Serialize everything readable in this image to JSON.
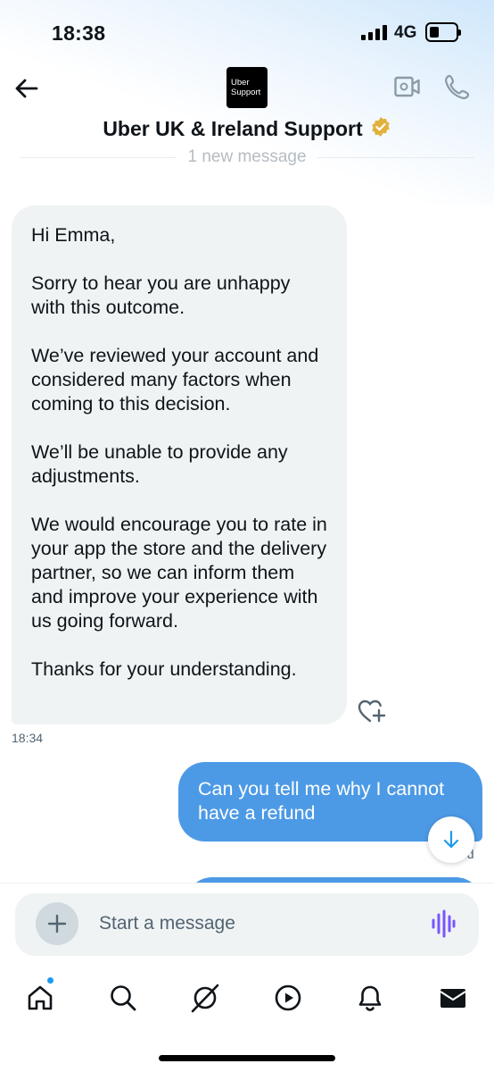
{
  "status_bar": {
    "time": "18:38",
    "network": "4G"
  },
  "header": {
    "logo_line1": "Uber",
    "logo_line2": "Support",
    "title": "Uber UK & Ireland Support",
    "verified_color": "#e2b13c"
  },
  "divider": {
    "label": "1 new message"
  },
  "messages": {
    "incoming": {
      "paragraphs": [
        "Hi Emma,",
        "Sorry to hear you are unhappy with this outcome.",
        "We’ve reviewed your account and considered many factors when coming to this decision.",
        "We’ll be unable to provide any adjustments.",
        "We would encourage you to rate in your app the store and the delivery partner, so we can inform them and improve your experience with us going forward.",
        "Thanks for your understanding."
      ],
      "time": "18:34"
    },
    "outgoing": {
      "text": "Can you tell me why I cannot have a refund",
      "status_fragment": "ed"
    }
  },
  "composer": {
    "placeholder": "Start a message"
  },
  "nav": [
    "home-icon",
    "search-icon",
    "grok-icon",
    "video-icon",
    "notifications-icon",
    "messages-icon"
  ],
  "colors": {
    "accent": "#1d9bf0",
    "outgoing_bubble": "#4c9ae6",
    "incoming_bubble": "#eff3f4",
    "voice": "#7856ff"
  }
}
